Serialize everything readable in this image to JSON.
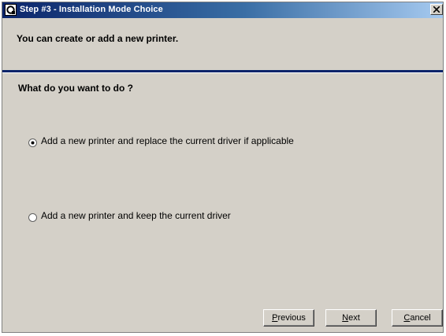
{
  "window": {
    "title": "Step #3 - Installation Mode Choice",
    "close_glyph": "X",
    "icon": "printer-setup-icon"
  },
  "header": {
    "text": "You can create or add a new printer.",
    "separator_color": "#0a246a"
  },
  "question": {
    "text": "What do you want to do ?"
  },
  "options": [
    {
      "label": "Add a new printer and replace the current driver if applicable",
      "selected": true
    },
    {
      "label": "Add a new printer and keep the current driver",
      "selected": false
    }
  ],
  "buttons": {
    "previous": {
      "accel": "P",
      "rest": "revious"
    },
    "next": {
      "accel": "N",
      "rest": "ext"
    },
    "cancel": {
      "accel": "C",
      "rest": "ancel"
    }
  },
  "colors": {
    "dialog_bg": "#d4d0c8",
    "titlebar_start": "#0a246a",
    "titlebar_end": "#a6caf0"
  }
}
